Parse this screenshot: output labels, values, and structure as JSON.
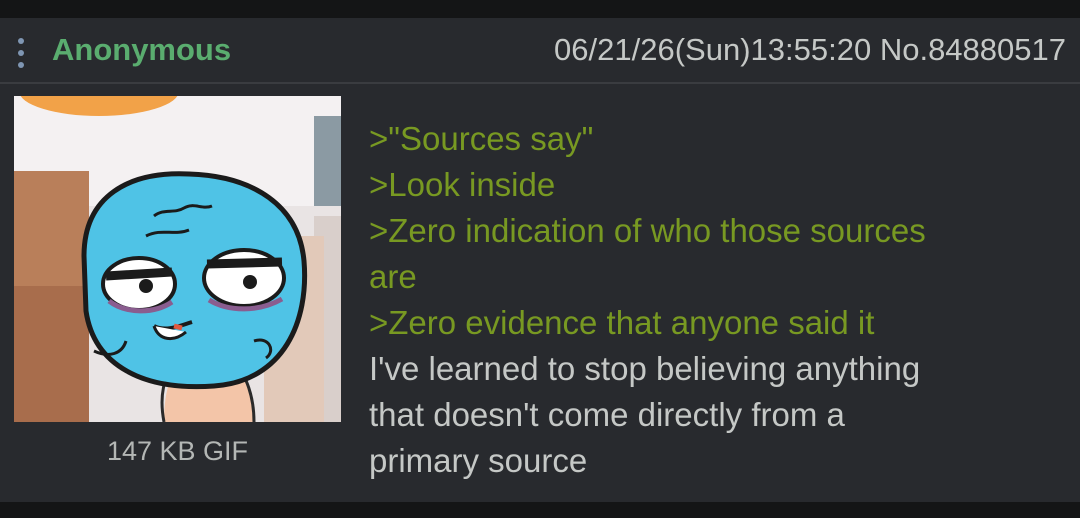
{
  "post": {
    "name": "Anonymous",
    "datetime": "06/21/26(Sun)13:55:20",
    "post_number": "No.84880517",
    "file": {
      "size": "147 KB",
      "format": "GIF",
      "label": "147 KB GIF",
      "thumbnail_icon": "gumball-smug-face-image"
    },
    "comment_lines": [
      ">\"Sources say\"",
      ">Look inside",
      ">Zero indication of who those sources",
      "are",
      ">Zero evidence that anyone said it",
      "I've learned to stop believing anything",
      "that doesn't come directly from a",
      "primary source"
    ]
  },
  "colors": {
    "background": "#1a1b1d",
    "post_background": "#282a2e",
    "name": "#5aad6f",
    "greentext": "#789922",
    "text": "#c5c8c6",
    "menu_icon": "#7f96b3"
  },
  "icons": {
    "menu": "vertical-dots-menu-icon"
  }
}
